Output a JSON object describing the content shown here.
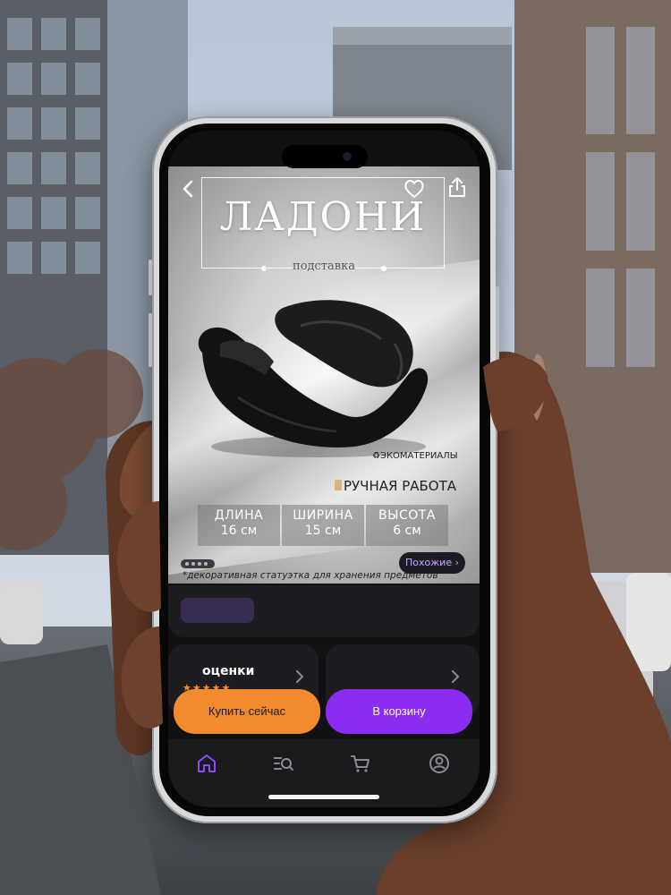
{
  "product": {
    "title": "ЛАДОНИ",
    "subtitle": "подставка",
    "eco_badge": "ЭКОМАТЕРИАЛЫ",
    "handmade_badge": "РУЧНАЯ РАБОТА",
    "dimensions": [
      {
        "label": "ДЛИНА",
        "value": "16 см"
      },
      {
        "label": "ШИРИНА",
        "value": "15 см"
      },
      {
        "label": "ВЫСОТА",
        "value": "6 см"
      }
    ],
    "caption": "*декоративная статуэтка для хранения предметов",
    "similar_label": "Похожие ›",
    "pager_dots": 4
  },
  "header_icons": [
    "back-icon",
    "heart-icon",
    "share-icon"
  ],
  "reviews": {
    "title": "оценки",
    "stars": "★★★★★"
  },
  "actions": {
    "buy_now": "Купить сейчас",
    "add_to_cart": "В корзину"
  },
  "tabbar": [
    "home-icon",
    "catalog-search-icon",
    "cart-icon",
    "profile-icon"
  ],
  "colors": {
    "buy_button": "#f28a2e",
    "cart_button": "#8a2df0",
    "active_tab": "#8a4cff",
    "inactive_tab": "#8b8b93",
    "stars": "#ff8a1f"
  }
}
